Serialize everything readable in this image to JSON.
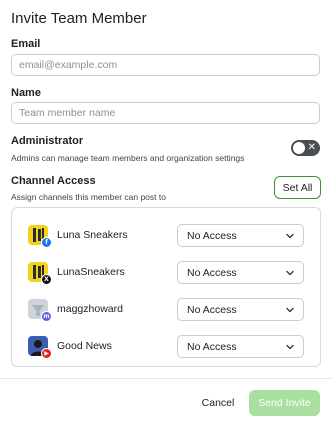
{
  "dialog": {
    "title": "Invite Team Member"
  },
  "email": {
    "label": "Email",
    "placeholder": "email@example.com",
    "value": ""
  },
  "name": {
    "label": "Name",
    "placeholder": "Team member name",
    "value": ""
  },
  "administrator": {
    "title": "Administrator",
    "description": "Admins can manage team members and organization settings",
    "enabled": false,
    "toggle_glyph": "✕"
  },
  "channel_access": {
    "title": "Channel Access",
    "description": "Assign channels this member can post to",
    "set_all_label": "Set All",
    "channels": [
      {
        "name": "Luna Sneakers",
        "network": "facebook",
        "badge_glyph": "f",
        "badge_color": "#1877f2",
        "access": "No Access"
      },
      {
        "name": "LunaSneakers",
        "network": "x",
        "badge_glyph": "X",
        "badge_color": "#111111",
        "access": "No Access"
      },
      {
        "name": "maggzhoward",
        "network": "mastodon",
        "badge_glyph": "m",
        "badge_color": "#5b5fe6",
        "access": "No Access"
      },
      {
        "name": "Good News",
        "network": "youtube",
        "badge_glyph": "▶",
        "badge_color": "#e62117",
        "access": "No Access"
      }
    ]
  },
  "footer": {
    "cancel_label": "Cancel",
    "send_label": "Send Invite"
  },
  "colors": {
    "accent_green": "#3f8f3f",
    "send_disabled": "#a9dfa0",
    "toggle_off": "#4a4d52"
  }
}
